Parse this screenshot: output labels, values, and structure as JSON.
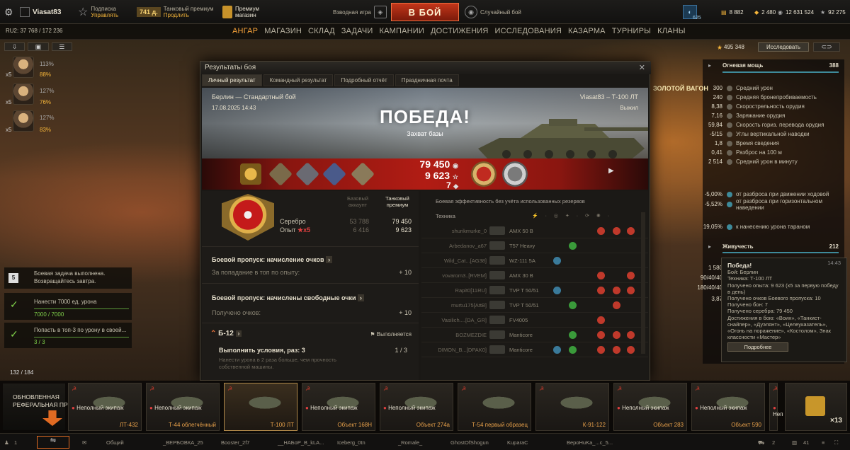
{
  "topbar": {
    "username": "Viasat83",
    "subscription": "Подписка",
    "manage": "Управлять",
    "days": "741",
    "days_suffix": "д.",
    "tank_premium": "Танковый премиум",
    "extend": "Продлить",
    "premium_shop": "Премиум",
    "premium_shop2": "магазин",
    "platoon": "Взводная игра",
    "battle_button": "В БОЙ",
    "random_battle": "Случайный бой",
    "counter_badge": "625",
    "gold": "8 882",
    "bonds": "2 480",
    "credits": "12 631 524",
    "free_xp": "92 275"
  },
  "nav": {
    "ru_stat": "RU2: 37 768 / 172 236",
    "items": [
      "АНГАР",
      "МАГАЗИН",
      "СКЛАД",
      "ЗАДАЧИ",
      "КАМПАНИИ",
      "ДОСТИЖЕНИЯ",
      "ИССЛЕДОВАНИЯ",
      "КАЗАРМА",
      "ТУРНИРЫ",
      "КЛАНЫ"
    ],
    "research_xp": "495 348",
    "research_button": "Исследовать"
  },
  "crew": {
    "stats": [
      "113%",
      "88%",
      "127%",
      "76%",
      "127%",
      "83%"
    ],
    "counts": [
      "x5",
      "x5",
      "x5"
    ]
  },
  "tasks": {
    "count_badge": "5",
    "done_line1": "Боевая задача выполнена.",
    "done_line2": "Возвращайтесь завтра.",
    "task1_title": "Нанести 7000 ед. урона",
    "task1_progress": "7000 / 7000",
    "task2_title": "Попасть в топ-3 по урону в своей...",
    "task2_progress": "3 / 3",
    "bottom_count": "132 / 184"
  },
  "right_panel": {
    "firepower": "Огневая мощь",
    "firepower_val": "388",
    "stats": [
      {
        "val": "300",
        "name": "Средний урон"
      },
      {
        "val": "240",
        "name": "Средняя бронепробиваемость"
      },
      {
        "val": "8,38",
        "name": "Скорострельность орудия"
      },
      {
        "val": "7,16",
        "name": "Заряжание орудия"
      },
      {
        "val": "59,84",
        "name": "Скорость гориз. перевода орудия"
      },
      {
        "val": "-5/15",
        "name": "Углы вертикальной наводки"
      },
      {
        "val": "1,8",
        "name": "Время сведения"
      },
      {
        "val": "0,41",
        "name": "Разброс на 100 м"
      },
      {
        "val": "2 514",
        "name": "Средний урон в минуту"
      }
    ],
    "stats2": [
      {
        "val": "-5,00%",
        "name": "от разброса при движении ходовой"
      },
      {
        "val": "-5,52%",
        "name": "от разброса при горизонтальном наведении"
      },
      {
        "val": "19,05%",
        "name": "к нанесению урона тараном"
      }
    ],
    "survivability": "Живучесть",
    "survivability_val": "212",
    "sv_vals": [
      "1 580",
      "90/40/40",
      "180/40/40",
      "3,87"
    ],
    "golden_wagon": "ЗОЛОТОЙ ВАГОН"
  },
  "tooltip": {
    "title": "Победа!",
    "time": "14:43",
    "lines": [
      "Бой: Берлин",
      "Техника: Т-100 ЛТ",
      "Получено опыта: 9 623 (x5 за первую победу в день)",
      "Получено очков Боевого пропуска: 10",
      "Получено бон: 7",
      "Получено серебра: 79 450",
      "Достижения в бою: «Воин», «Танкист-снайпер», «Дуэлянт», «Целеуказатель», «Огонь на поражение», «Костолом», Знак классности «Мастер»"
    ],
    "button": "Подробнее"
  },
  "dialog": {
    "title": "Результаты боя",
    "tabs": [
      "Личный результат",
      "Командный результат",
      "Подробный отчёт",
      "Праздничная почта"
    ],
    "map": "Берлин — Стандартный бой",
    "date": "17.08.2025 14:43",
    "player": "Viasat83 – Т-100 ЛТ",
    "alive": "Выжил",
    "victory": "ПОБЕДА!",
    "victory_sub": "Захват базы",
    "credits": "79 450",
    "xp": "9 623",
    "bonds": "7",
    "col_basic": "Базовый аккаунт",
    "col_premium": "Танковый премиум",
    "silver_label": "Серебро",
    "exp_label": "Опыт",
    "silver_basic": "53 788",
    "silver_prem": "79 450",
    "exp_basic": "6 416",
    "exp_prem": "9 623",
    "exp_mult": "x5",
    "bp_title1": "Боевой пропуск: начисление очков",
    "bp_line1": "За попадание в топ по опыту:",
    "bp_val1": "+ 10",
    "bp_title2": "Боевой пропуск: начислены свободные очки",
    "bp_line2": "Получено очков:",
    "bp_val2": "+ 10",
    "mission_code": "Б-12",
    "mission_status": "Выполняется",
    "mission_cond": "Выполнить условия, раз: 3",
    "mission_count": "1 / 3",
    "mission_desc1": "Нанести урона в 2 раза больше, чем прочность",
    "mission_desc2": "собственной машины.",
    "eff_title": "Боевая эффективность без учёта использованных резервов",
    "tech_col": "Техника",
    "rows": [
      {
        "player": "shurikmurke_0",
        "tank": "AMX 50 B"
      },
      {
        "player": "Arbedanov_a67",
        "tank": "T57 Heavy"
      },
      {
        "player": "Wild_Cat...[AG38]",
        "tank": "WZ-111 5A"
      },
      {
        "player": "vovarom3..[RVEM]",
        "tank": "AMX 30 B"
      },
      {
        "player": "Rapit0[11RU]",
        "tank": "TVP T 50/51"
      },
      {
        "player": "murtu175[AttB]",
        "tank": "TVP T 50/51"
      },
      {
        "player": "Vasilich....[DA_GR]",
        "tank": "FV4005"
      },
      {
        "player": "BOZMEZDIE",
        "tank": "Manticore"
      },
      {
        "player": "DIMON_B...[DPAK0]",
        "tank": "Manticore"
      }
    ]
  },
  "carousel": {
    "referral1": "ОБНОВЛЕННАЯ",
    "referral2": "РЕФЕРАЛЬНАЯ ПРОГРАММА",
    "tanks": [
      {
        "name": "ЛТ-432",
        "crew": "Неполный экипаж"
      },
      {
        "name": "Т-44 облегчённый",
        "crew": "Неполный экипаж"
      },
      {
        "name": "Т-100 ЛТ",
        "crew": ""
      },
      {
        "name": "Объект 168Н",
        "crew": "Неполный экипаж"
      },
      {
        "name": "Объект 274а",
        "crew": "Неполный экипаж"
      },
      {
        "name": "Т-54 первый образец",
        "crew": ""
      },
      {
        "name": "К-91-122",
        "crew": ""
      },
      {
        "name": "Объект 283",
        "crew": "Неполный экипаж"
      },
      {
        "name": "Объект 590",
        "crew": "Неполный экипаж"
      },
      {
        "name": "",
        "crew": "Неп"
      }
    ],
    "more_count": "×13"
  },
  "chatbar": {
    "count1": "1",
    "channels": [
      "Общий",
      "_ВЕРБОВКА_25",
      "Booster_2f7",
      "__НАБоР_В_kLA...",
      "Iceberg_0tn",
      "_Romale_",
      "GhostOfShogun",
      "KuparaC",
      "ВерoHuKa_...c_5..."
    ],
    "right1": "2",
    "right2": "41"
  }
}
